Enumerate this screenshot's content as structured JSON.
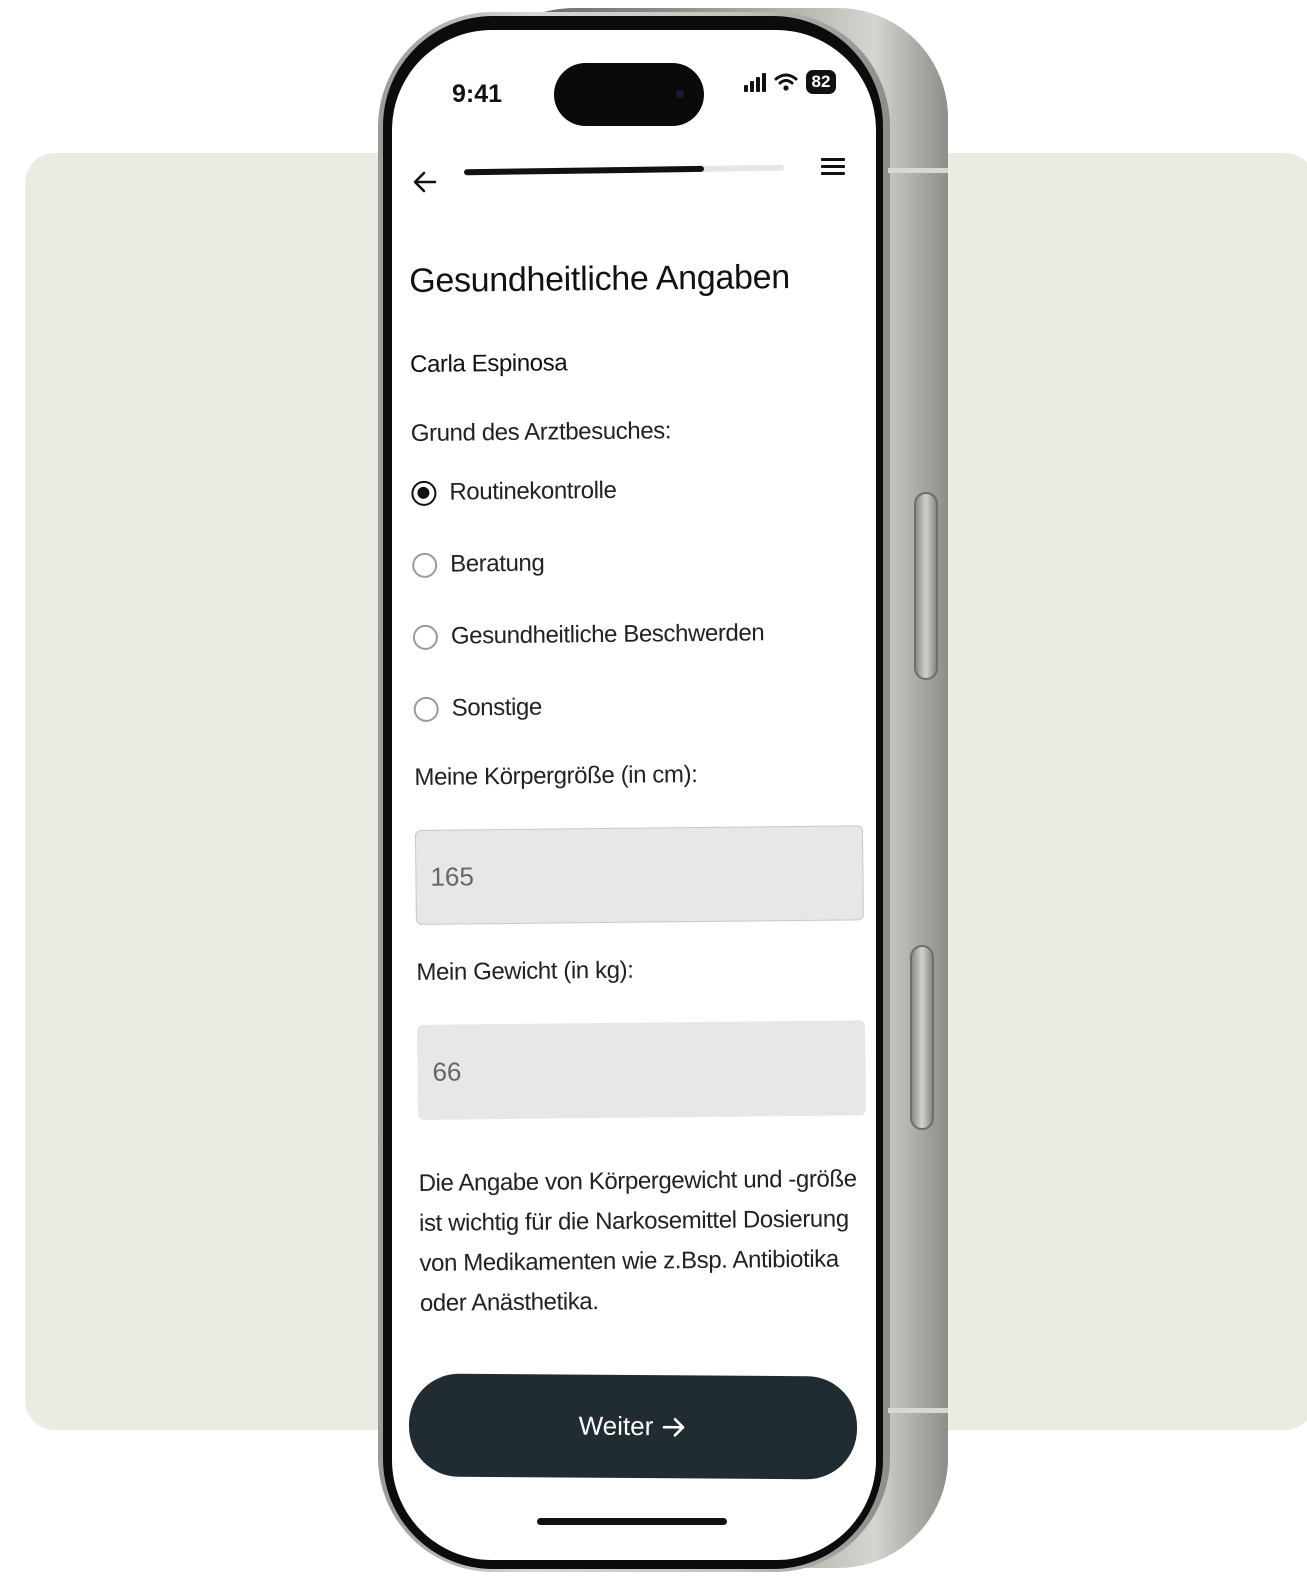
{
  "status_bar": {
    "time": "9:41",
    "battery": "82",
    "icons": [
      "signal-icon",
      "wifi-icon",
      "battery-icon"
    ]
  },
  "nav": {
    "back_icon": "arrow-left-icon",
    "menu_icon": "hamburger-menu-icon",
    "progress": 0.75
  },
  "form": {
    "title": "Gesundheitliche Angaben",
    "patient_name": "Carla Espinosa",
    "reason_label": "Grund des Arztbesuches:",
    "reason_options": [
      {
        "label": "Routinekontrolle",
        "selected": true
      },
      {
        "label": "Beratung",
        "selected": false
      },
      {
        "label": "Gesundheitliche Beschwerden",
        "selected": false
      },
      {
        "label": "Sonstige",
        "selected": false
      }
    ],
    "height_label": "Meine Körpergröße (in cm):",
    "height_value": "165",
    "weight_label": "Mein Gewicht (in kg):",
    "weight_value": "66",
    "hint": "Die Angabe von Körpergewicht und -größe ist wichtig für die Narkosemittel Dosierung von Medikamenten wie z.Bsp. Antibiotika oder Anästhetika.",
    "continue_label": "Weiter",
    "continue_icon": "arrow-right-icon"
  },
  "colors": {
    "backdrop": "#ecebe3",
    "cta": "#212b32",
    "input_bg": "#e7e7e7"
  }
}
